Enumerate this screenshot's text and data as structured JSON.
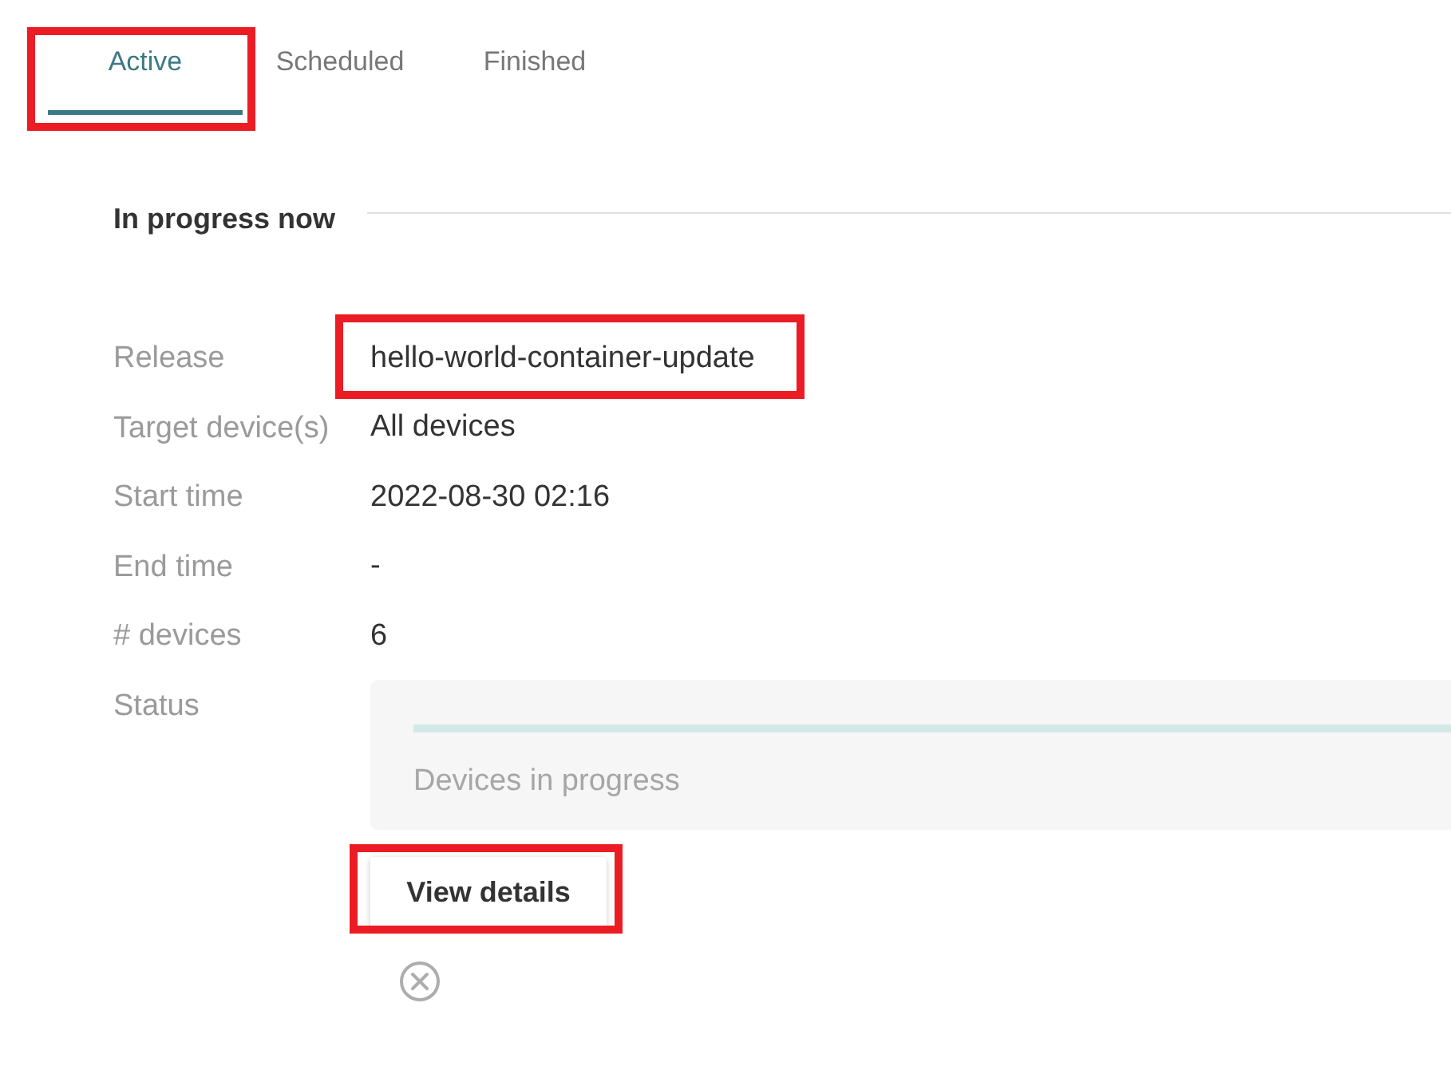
{
  "tabs": [
    {
      "label": "Active",
      "selected": true,
      "highlighted": true
    },
    {
      "label": "Scheduled",
      "selected": false,
      "highlighted": false
    },
    {
      "label": "Finished",
      "selected": false,
      "highlighted": false
    }
  ],
  "section": {
    "title": "In progress now"
  },
  "details": [
    {
      "kind": "text",
      "label": "Release",
      "value": "hello-world-container-update",
      "highlighted": true
    },
    {
      "kind": "text",
      "label": "Target device(s)",
      "value": "All devices",
      "highlighted": false
    },
    {
      "kind": "text",
      "label": "Start time",
      "value": "2022-08-30 02:16",
      "highlighted": false
    },
    {
      "kind": "text",
      "label": "End time",
      "value": "-",
      "highlighted": false
    },
    {
      "kind": "text",
      "label": "# devices",
      "value": "6",
      "highlighted": false
    },
    {
      "kind": "progress",
      "label": "Status",
      "caption": "Devices in progress"
    }
  ],
  "view_details": {
    "label": "View details",
    "highlighted": true
  }
}
